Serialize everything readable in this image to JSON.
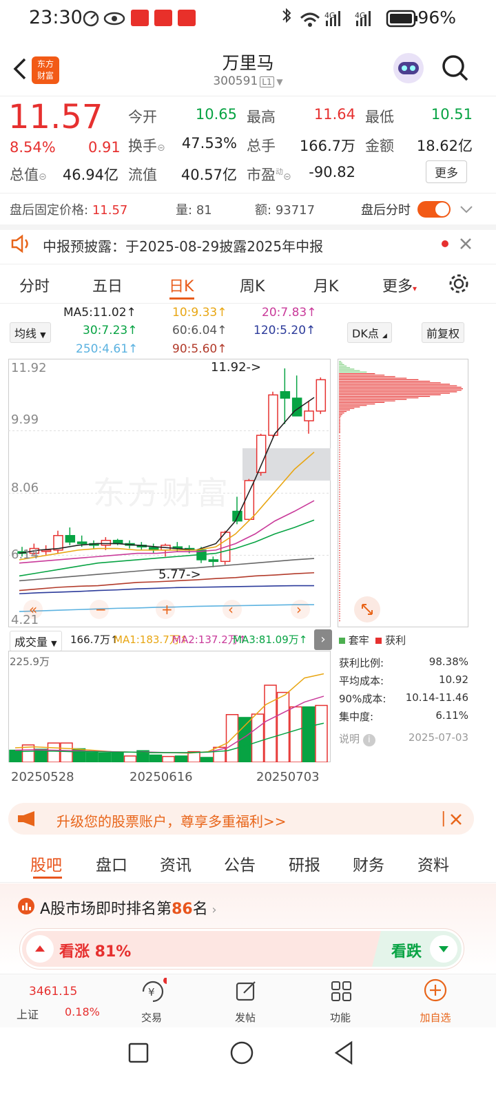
{
  "status_bar": {
    "time": "23:30",
    "battery": "96%",
    "network1": "4G",
    "network2": "4G"
  },
  "header": {
    "name": "万里马",
    "code": "300591",
    "level": "L1",
    "logo_text1": "东方",
    "logo_text2": "财富"
  },
  "quote": {
    "price": "11.57",
    "change_pct": "8.54%",
    "change": "0.91",
    "open_label": "今开",
    "open": "10.65",
    "high_label": "最高",
    "high": "11.64",
    "low_label": "最低",
    "low": "10.51",
    "turnover_label": "换手",
    "turnover": "47.53%",
    "volume_label": "总手",
    "volume": "166.7万",
    "amount_label": "金额",
    "amount": "18.62亿",
    "mktcap_label": "总值",
    "mktcap": "46.94亿",
    "float_label": "流值",
    "float": "40.57亿",
    "pe_label": "市盈",
    "pe_sup": "动",
    "pe": "-90.82",
    "more_btn": "更多"
  },
  "after_hours": {
    "price_label": "盘后固定价格:",
    "price": "11.57",
    "vol_label": "量:",
    "vol": "81",
    "amt_label": "额:",
    "amt": "93717",
    "toggle_label": "盘后分时",
    "toggle_on": true
  },
  "notice": {
    "text": "中报预披露：于2025-08-29披露2025年中报"
  },
  "ktabs": [
    "分时",
    "五日",
    "日K",
    "周K",
    "月K",
    "更多"
  ],
  "ktab_active": 2,
  "ma": {
    "ma5": "MA5:11.02↑",
    "ma10": "10:9.33↑",
    "ma20": "20:7.83↑",
    "ma30": "30:7.23↑",
    "ma60": "60:6.04↑",
    "ma120": "120:5.20↑",
    "ma250": "250:4.61↑",
    "ma90": "90:5.60↑",
    "dropdown": "均线",
    "dk": "DK点",
    "restore": "前复权"
  },
  "kchart": {
    "y_labels": [
      "11.92",
      "9.99",
      "8.06",
      "6.14",
      "4.21"
    ],
    "high_mark": "11.92->",
    "low_mark": "5.77->",
    "watermark": "东方财富"
  },
  "volume": {
    "dropdown": "成交量",
    "vol": "166.7万↑",
    "ma1": "MA1:183.7万↑",
    "ma2": "MA2:137.2万↑",
    "ma3": "MA3:81.09万↑",
    "max": "225.9万",
    "dates": [
      "20250528",
      "20250616",
      "20250703"
    ]
  },
  "chips": {
    "legend_trap": "套牢",
    "legend_profit": "获利",
    "rows": [
      {
        "label": "获利比例:",
        "value": "98.38%"
      },
      {
        "label": "平均成本:",
        "value": "10.92"
      },
      {
        "label": "90%成本:",
        "value": "10.14-11.46"
      },
      {
        "label": "集中度:",
        "value": "6.11%"
      }
    ],
    "note_label": "说明",
    "date": "2025-07-03"
  },
  "banner": {
    "text": "升级您的股票账户，尊享多重福利>>"
  },
  "subtabs": [
    "股吧",
    "盘口",
    "资讯",
    "公告",
    "研报",
    "财务",
    "资料"
  ],
  "subtab_active": 0,
  "rank": {
    "prefix": "A股市场即时排名第",
    "num": "86",
    "suffix": "名"
  },
  "vote": {
    "up": "看涨 81%",
    "down": "看跌",
    "up_pct": 81
  },
  "bottom_nav": {
    "index_value": "3461.15",
    "index_name": "上证",
    "index_pct": "0.18%",
    "items": [
      "交易",
      "发帖",
      "功能",
      "加自选"
    ]
  },
  "chart_data": [
    {
      "type": "candlestick",
      "title": "",
      "ylim": [
        4.21,
        11.92
      ],
      "annotations": [
        "11.92->",
        "5.77->"
      ]
    },
    {
      "type": "bar",
      "title": "成交量",
      "ylim": [
        0,
        225.9
      ],
      "dates": [
        "20250528",
        "20250616",
        "20250703"
      ]
    }
  ]
}
